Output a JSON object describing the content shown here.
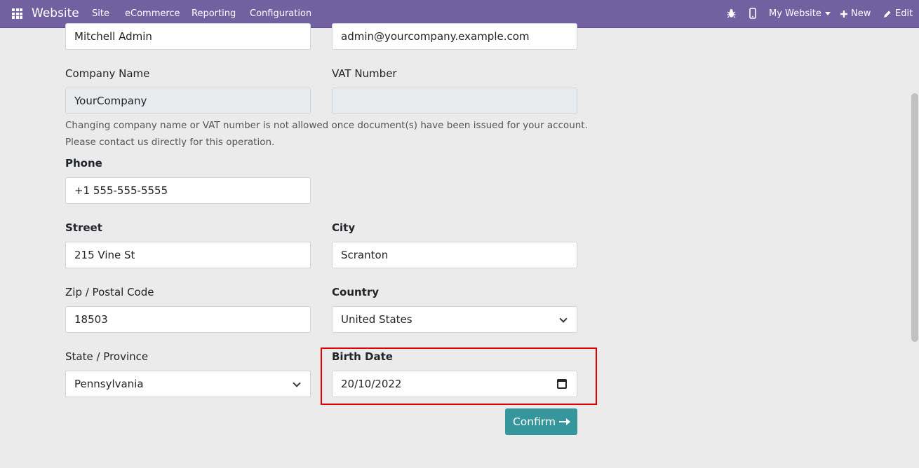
{
  "navbar": {
    "brand": "Website",
    "menu": [
      "Site",
      "eCommerce",
      "Reporting",
      "Configuration"
    ],
    "website_selector": "My Website",
    "new_label": "New",
    "edit_label": "Edit"
  },
  "form": {
    "name_value": "Mitchell Admin",
    "email_value": "admin@yourcompany.example.com",
    "company_name_label": "Company Name",
    "company_name_value": "YourCompany",
    "vat_label": "VAT Number",
    "vat_value": "",
    "help_line1": "Changing company name or VAT number is not allowed once document(s) have been issued for your account.",
    "help_line2": "Please contact us directly for this operation.",
    "phone_label": "Phone",
    "phone_value": "+1 555-555-5555",
    "street_label": "Street",
    "street_value": "215 Vine St",
    "city_label": "City",
    "city_value": "Scranton",
    "zip_label": "Zip / Postal Code",
    "zip_value": "18503",
    "country_label": "Country",
    "country_value": "United States",
    "state_label": "State / Province",
    "state_value": "Pennsylvania",
    "birth_date_label": "Birth Date",
    "birth_date_value": "20/10/2022",
    "confirm_label": "Confirm"
  },
  "colors": {
    "navbar": "#7260a0",
    "confirm_button": "#35979c",
    "highlight": "#e00000"
  }
}
